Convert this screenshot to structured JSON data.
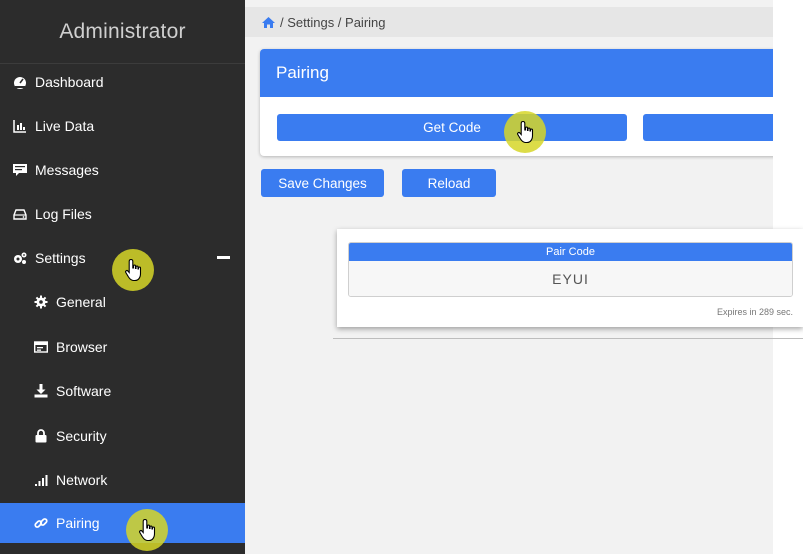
{
  "sidebar": {
    "brand": "Administrator",
    "items": [
      {
        "label": "Dashboard",
        "icon": "tachometer-icon"
      },
      {
        "label": "Live Data",
        "icon": "bar-chart-icon"
      },
      {
        "label": "Messages",
        "icon": "message-icon"
      },
      {
        "label": "Log Files",
        "icon": "hdd-icon"
      },
      {
        "label": "Settings",
        "icon": "cogs-icon",
        "expanded": true
      },
      {
        "label": "General",
        "icon": "gear-icon"
      },
      {
        "label": "Browser",
        "icon": "browser-icon"
      },
      {
        "label": "Software",
        "icon": "download-icon"
      },
      {
        "label": "Security",
        "icon": "lock-icon"
      },
      {
        "label": "Network",
        "icon": "signal-icon"
      },
      {
        "label": "Pairing",
        "icon": "link-icon",
        "active": true
      }
    ]
  },
  "breadcrumb": {
    "text": "/ Settings / Pairing",
    "icon": "home-icon"
  },
  "card": {
    "title": "Pairing",
    "get_code_label": "Get Code"
  },
  "actions": {
    "save_label": "Save Changes",
    "reload_label": "Reload"
  },
  "popup": {
    "header": "Pair Code",
    "code": "EYUI",
    "expires": "Expires in 289 sec."
  },
  "colors": {
    "accent": "#3a7cf0",
    "sidebar_bg": "#2c2c2c",
    "highlight": "#d6d628"
  }
}
